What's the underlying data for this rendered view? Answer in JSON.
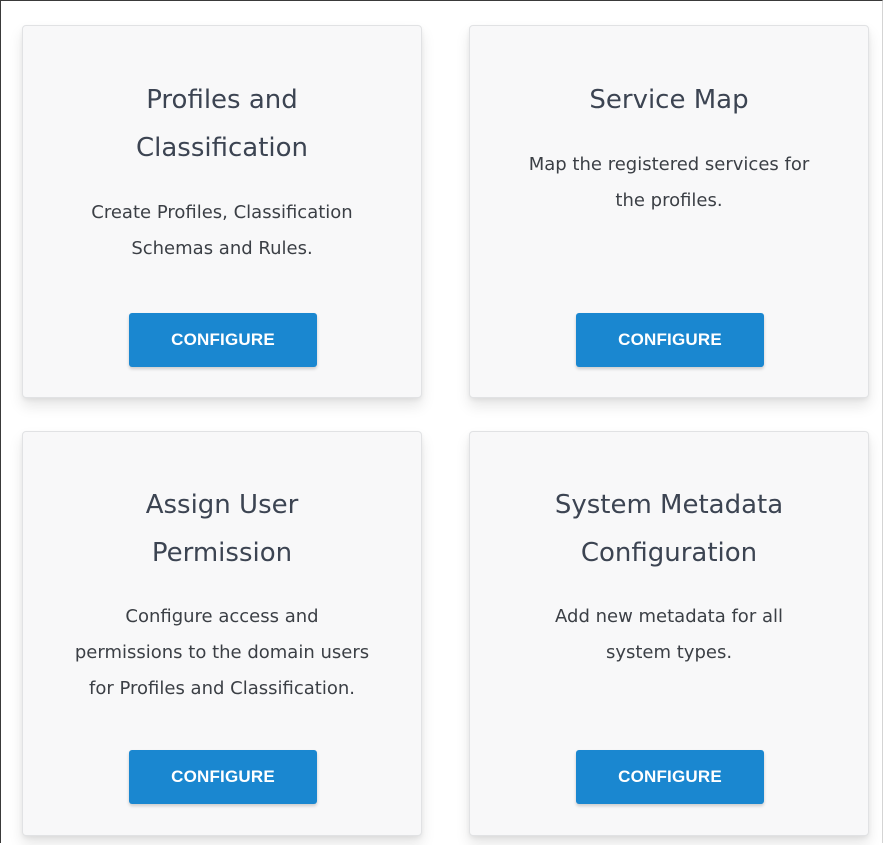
{
  "cards": [
    {
      "title": "Profiles and Classification",
      "description": "Create Profiles, Classification Schemas and Rules.",
      "button_label": "CONFIGURE"
    },
    {
      "title": "Service Map",
      "description": "Map the registered services for the profiles.",
      "button_label": "CONFIGURE"
    },
    {
      "title": "Assign User Permission",
      "description": "Configure access and permissions to the domain users for Profiles and Classification.",
      "button_label": "CONFIGURE"
    },
    {
      "title": "System Metadata Configuration",
      "description": "Add new metadata for all system types.",
      "button_label": "CONFIGURE"
    }
  ],
  "colors": {
    "card_background": "#f8f8f9",
    "title_text": "#3c4452",
    "body_text": "#3b3f45",
    "button_background": "#1a87d0",
    "button_text": "#ffffff"
  }
}
